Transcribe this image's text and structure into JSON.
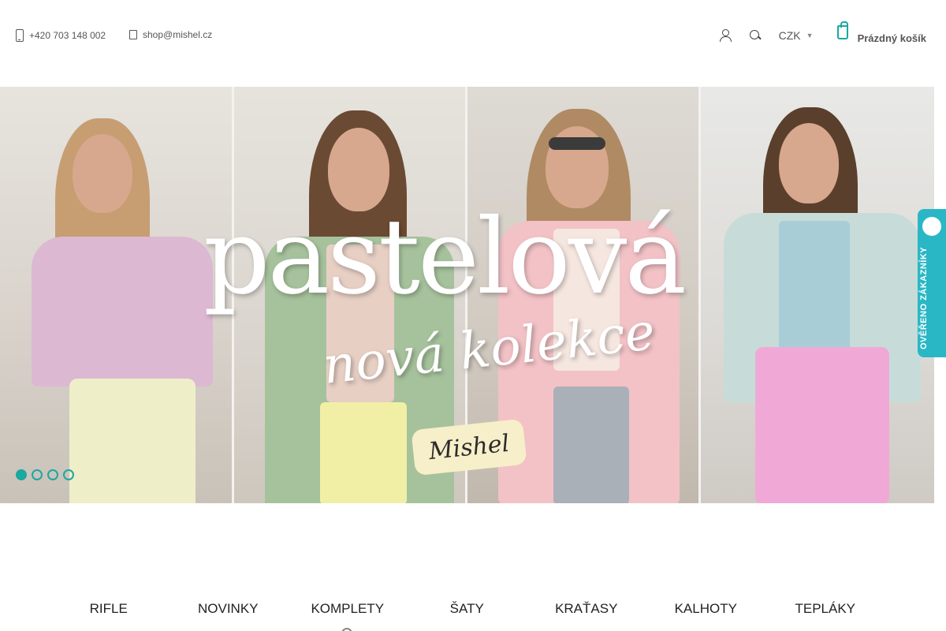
{
  "header": {
    "phone": "+420 703 148 002",
    "email": "shop@mishel.cz",
    "currency": "CZK",
    "cart_label": "Prázdný košík",
    "icons": [
      "phone-icon",
      "mail-icon",
      "user-icon",
      "search-icon",
      "chevron-down-icon",
      "cart-icon"
    ],
    "accent_color": "#1aa8a0"
  },
  "hero": {
    "title": "pastelová",
    "subtitle": "nová kolekce",
    "brand": "Mishel",
    "slides": 4,
    "active_slide": 1
  },
  "verified_badge": {
    "label": "OVĚŘENO ZÁKAZNÍKY",
    "color": "#2ab7c5"
  },
  "categories": [
    "RIFLE",
    "NOVINKY",
    "KOMPLETY",
    "ŠATY",
    "KRAŤASY",
    "KALHOTY",
    "TEPLÁKY"
  ]
}
